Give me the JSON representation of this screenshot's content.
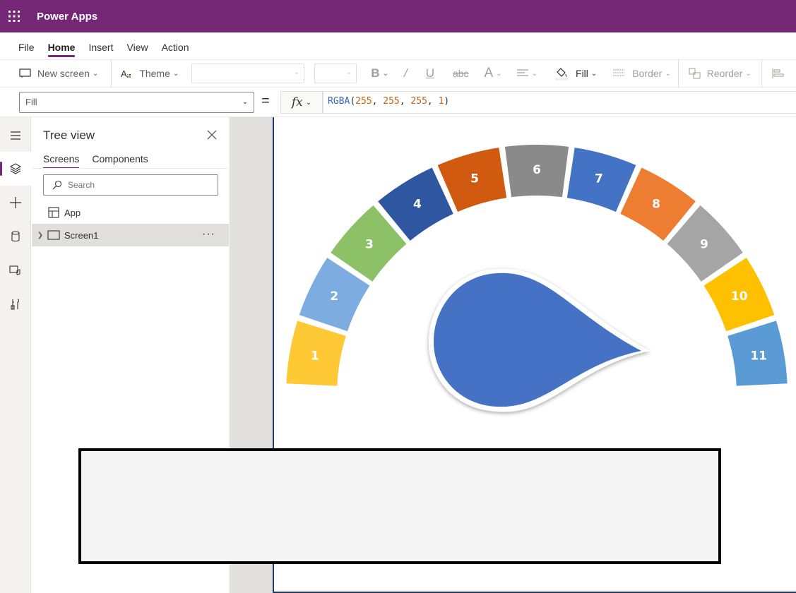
{
  "app": {
    "title": "Power Apps"
  },
  "menu": {
    "items": [
      "File",
      "Home",
      "Insert",
      "View",
      "Action"
    ],
    "active": "Home"
  },
  "ribbon": {
    "new_screen": "New screen",
    "theme": "Theme",
    "fill": "Fill",
    "border": "Border",
    "reorder": "Reorder"
  },
  "formula_bar": {
    "property": "Fill",
    "equals": "=",
    "fx": "fx",
    "function_name": "RGBA",
    "args": [
      "255",
      "255",
      "255",
      "1"
    ]
  },
  "tree_view": {
    "title": "Tree view",
    "tabs": [
      "Screens",
      "Components"
    ],
    "active_tab": "Screens",
    "search_placeholder": "Search",
    "items": [
      {
        "label": "App",
        "icon": "app-icon",
        "selected": false
      },
      {
        "label": "Screen1",
        "icon": "screen-icon",
        "selected": true
      }
    ],
    "more_label": "···"
  },
  "gauge": {
    "segments": [
      {
        "label": "1",
        "color": "#ffc936"
      },
      {
        "label": "2",
        "color": "#7cace0"
      },
      {
        "label": "3",
        "color": "#8cc168"
      },
      {
        "label": "4",
        "color": "#2f56a0"
      },
      {
        "label": "5",
        "color": "#d05b10"
      },
      {
        "label": "6",
        "color": "#8a8a8a"
      },
      {
        "label": "7",
        "color": "#4472c4"
      },
      {
        "label": "8",
        "color": "#ed7d31"
      },
      {
        "label": "9",
        "color": "#a5a5a5"
      },
      {
        "label": "10",
        "color": "#ffc000"
      },
      {
        "label": "11",
        "color": "#5b9bd5"
      }
    ],
    "needle_color": "#4472c4"
  },
  "colors": {
    "brand": "#742774",
    "screen_border": "#1f3864"
  }
}
